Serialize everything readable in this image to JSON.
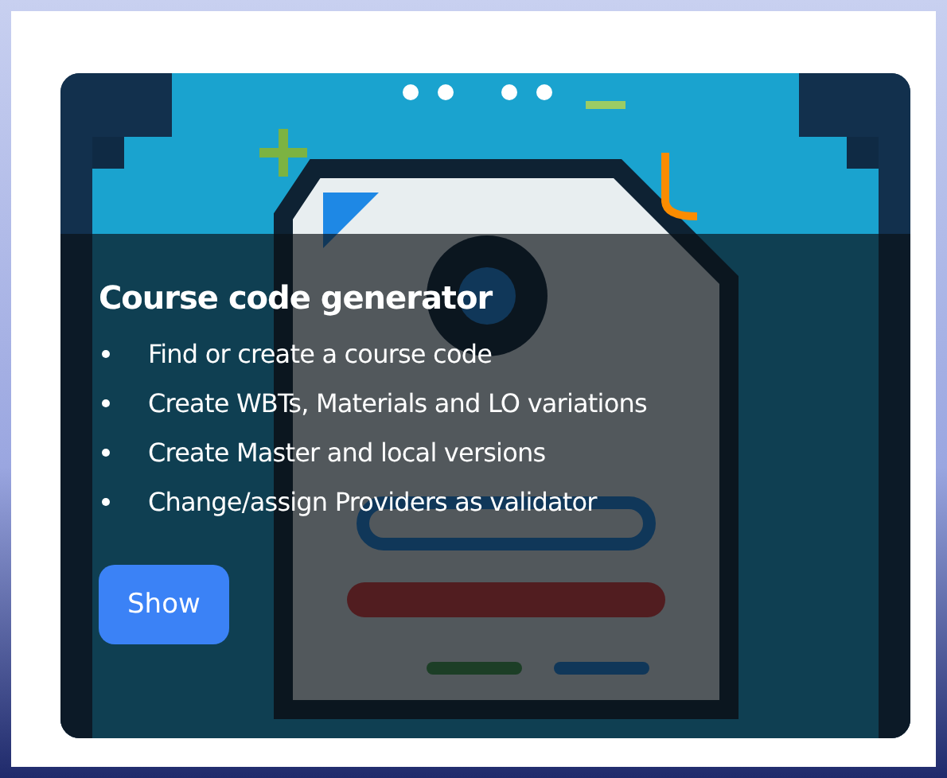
{
  "card": {
    "title": "Course code generator",
    "features": [
      "Find or create a course code",
      "Create WBTs, Materials and LO variations",
      "Create Master and local versions",
      "Change/assign Providers as validator"
    ],
    "button": "Show"
  }
}
